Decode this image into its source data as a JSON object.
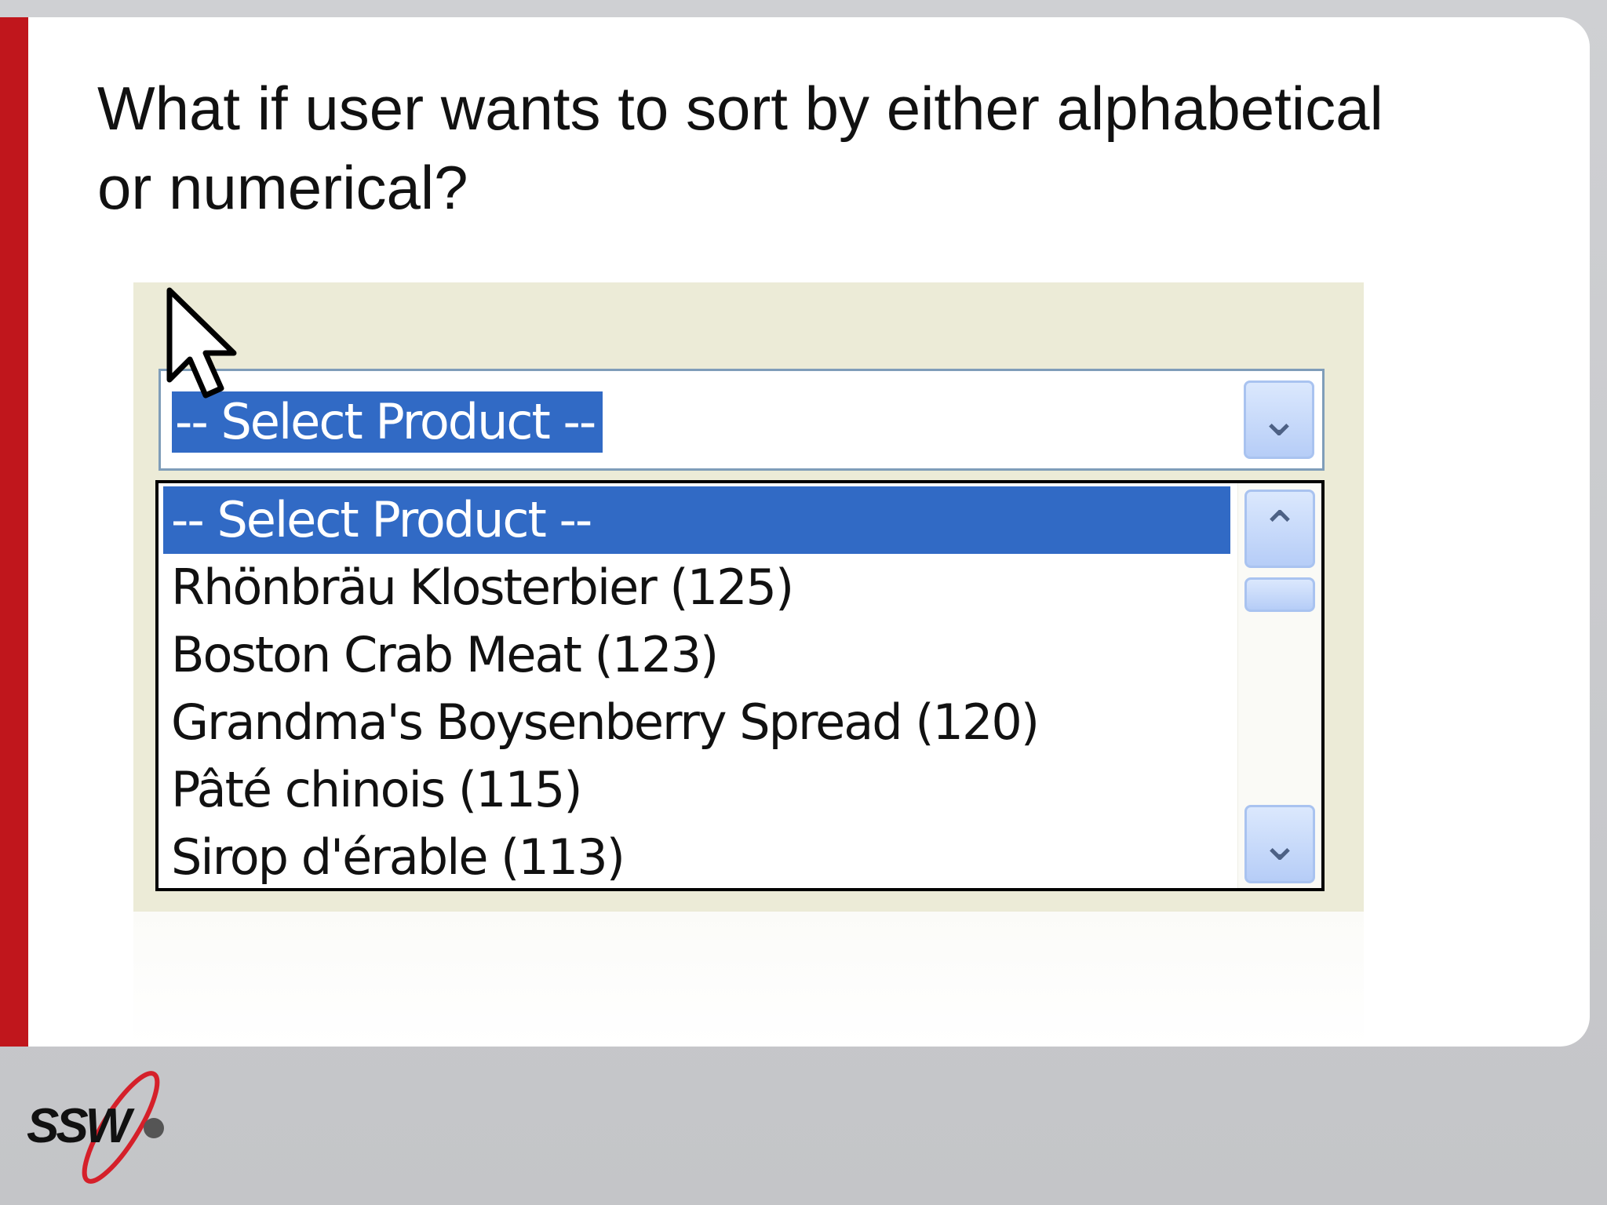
{
  "slide": {
    "title_line1": "What if user wants to sort by either alphabetical",
    "title_line2": "or numerical?"
  },
  "dropdown": {
    "selected_value": "-- Select Product --",
    "options": [
      "-- Select Product --",
      "Rhönbräu Klosterbier (125)",
      "Boston Crab Meat (123)",
      "Grandma's Boysenberry Spread (120)",
      "Pâté chinois (115)",
      "Sirop d'érable (113)"
    ],
    "highlighted_index": 0
  },
  "icons": {
    "dropdown_arrow": "chevron-down-icon",
    "scroll_up": "chevron-up-icon",
    "scroll_down": "chevron-down-icon",
    "cursor": "mouse-pointer-icon",
    "logo": "ssw-logo"
  },
  "colors": {
    "accent_bar": "#c0161c",
    "selection": "#316ac5",
    "screenshot_bg": "#ecebd7"
  },
  "logo": {
    "text": "SSW"
  }
}
